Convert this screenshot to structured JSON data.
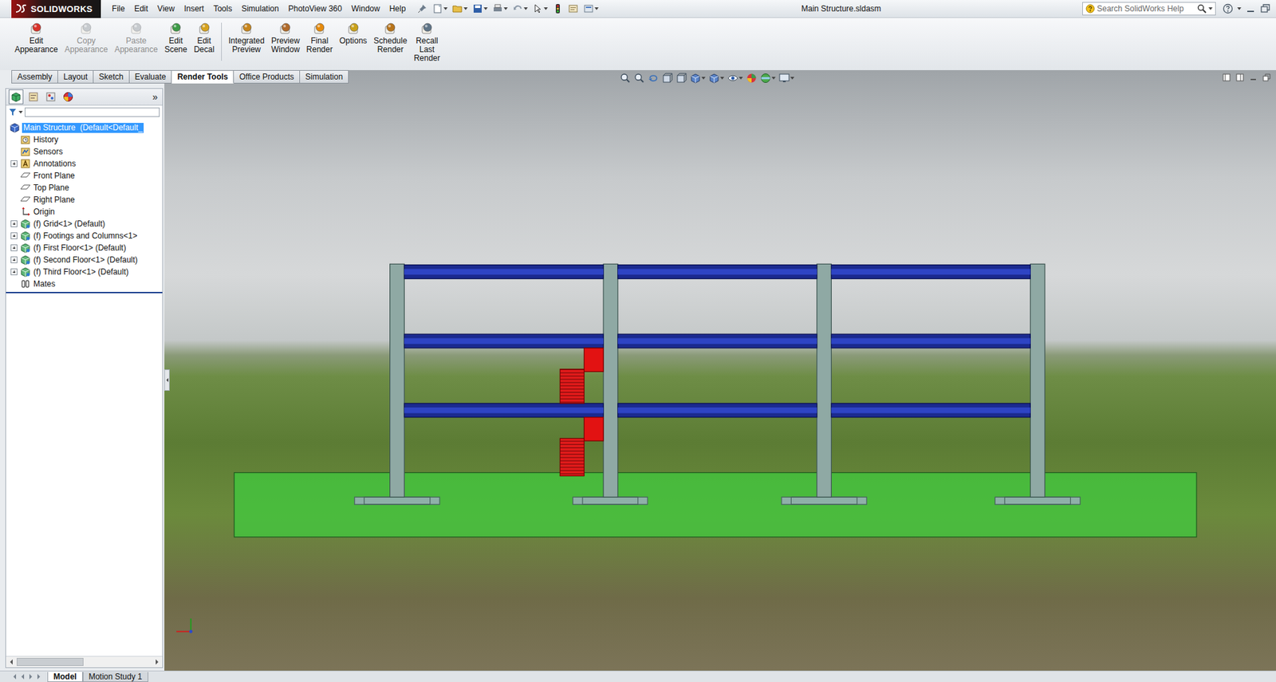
{
  "window": {
    "title": "Main Structure.sldasm",
    "logo": "SOLIDWORKS"
  },
  "menu": [
    "File",
    "Edit",
    "View",
    "Insert",
    "Tools",
    "Simulation",
    "PhotoView 360",
    "Window",
    "Help"
  ],
  "search": {
    "placeholder": "Search SolidWorks Help"
  },
  "ribbon": {
    "groups": [
      [
        {
          "label": "Edit Appearance",
          "disabled": false
        },
        {
          "label": "Copy Appearance",
          "disabled": true
        },
        {
          "label": "Paste Appearance",
          "disabled": true
        },
        {
          "label": "Edit Scene",
          "disabled": false
        },
        {
          "label": "Edit Decal",
          "disabled": false
        }
      ],
      [
        {
          "label": "Integrated Preview",
          "disabled": false
        },
        {
          "label": "Preview Window",
          "disabled": false
        },
        {
          "label": "Final Render",
          "disabled": false
        },
        {
          "label": "Options",
          "disabled": false
        },
        {
          "label": "Schedule Render",
          "disabled": false
        },
        {
          "label": "Recall Last Render",
          "disabled": false
        }
      ]
    ]
  },
  "tabs": [
    {
      "label": "Assembly",
      "selected": false
    },
    {
      "label": "Layout",
      "selected": false
    },
    {
      "label": "Sketch",
      "selected": false
    },
    {
      "label": "Evaluate",
      "selected": false
    },
    {
      "label": "Render Tools",
      "selected": true
    },
    {
      "label": "Office Products",
      "selected": false
    },
    {
      "label": "Simulation",
      "selected": false
    }
  ],
  "panel": {
    "more": "»"
  },
  "tree": {
    "root": {
      "label": "Main Structure  (Default<Default_",
      "selected": true
    },
    "items": [
      {
        "label": "History",
        "kind": "history",
        "expandable": false
      },
      {
        "label": "Sensors",
        "kind": "sensors",
        "expandable": false
      },
      {
        "label": "Annotations",
        "kind": "annotations",
        "expandable": true
      },
      {
        "label": "Front Plane",
        "kind": "plane",
        "expandable": false
      },
      {
        "label": "Top Plane",
        "kind": "plane",
        "expandable": false
      },
      {
        "label": "Right Plane",
        "kind": "plane",
        "expandable": false
      },
      {
        "label": "Origin",
        "kind": "origin",
        "expandable": false
      },
      {
        "label": "(f) Grid<1> (Default)",
        "kind": "part",
        "expandable": true
      },
      {
        "label": "(f) Footings and Columns<1>",
        "kind": "part",
        "expandable": true
      },
      {
        "label": "(f) First Floor<1> (Default)",
        "kind": "part",
        "expandable": true
      },
      {
        "label": "(f) Second Floor<1> (Default)",
        "kind": "part",
        "expandable": true
      },
      {
        "label": "(f) Third Floor<1> (Default)",
        "kind": "part",
        "expandable": true
      },
      {
        "label": "Mates",
        "kind": "mates",
        "expandable": false
      }
    ]
  },
  "bottom_tabs": [
    {
      "label": "Model",
      "selected": true
    },
    {
      "label": "Motion Study 1",
      "selected": false
    }
  ]
}
